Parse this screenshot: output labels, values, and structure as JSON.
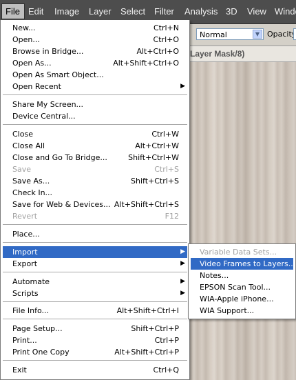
{
  "menubar": {
    "items": [
      "File",
      "Edit",
      "Image",
      "Layer",
      "Select",
      "Filter",
      "Analysis",
      "3D",
      "View",
      "Windo"
    ]
  },
  "options": {
    "blend_mode": "Normal",
    "opacity_label": "Opacity:"
  },
  "document_tab": "Layer Mask/8)",
  "file_menu": {
    "items": [
      {
        "label": "New...",
        "shortcut": "Ctrl+N"
      },
      {
        "label": "Open...",
        "shortcut": "Ctrl+O"
      },
      {
        "label": "Browse in Bridge...",
        "shortcut": "Alt+Ctrl+O"
      },
      {
        "label": "Open As...",
        "shortcut": "Alt+Shift+Ctrl+O"
      },
      {
        "label": "Open As Smart Object...",
        "shortcut": ""
      },
      {
        "label": "Open Recent",
        "shortcut": "",
        "submenu": true
      },
      {
        "label": "Share My Screen...",
        "shortcut": ""
      },
      {
        "label": "Device Central...",
        "shortcut": ""
      },
      {
        "label": "Close",
        "shortcut": "Ctrl+W"
      },
      {
        "label": "Close All",
        "shortcut": "Alt+Ctrl+W"
      },
      {
        "label": "Close and Go To Bridge...",
        "shortcut": "Shift+Ctrl+W"
      },
      {
        "label": "Save",
        "shortcut": "Ctrl+S",
        "disabled": true
      },
      {
        "label": "Save As...",
        "shortcut": "Shift+Ctrl+S"
      },
      {
        "label": "Check In...",
        "shortcut": ""
      },
      {
        "label": "Save for Web & Devices...",
        "shortcut": "Alt+Shift+Ctrl+S"
      },
      {
        "label": "Revert",
        "shortcut": "F12",
        "disabled": true
      },
      {
        "label": "Place...",
        "shortcut": ""
      },
      {
        "label": "Import",
        "shortcut": "",
        "submenu": true,
        "highlighted": true
      },
      {
        "label": "Export",
        "shortcut": "",
        "submenu": true
      },
      {
        "label": "Automate",
        "shortcut": "",
        "submenu": true
      },
      {
        "label": "Scripts",
        "shortcut": "",
        "submenu": true
      },
      {
        "label": "File Info...",
        "shortcut": "Alt+Shift+Ctrl+I"
      },
      {
        "label": "Page Setup...",
        "shortcut": "Shift+Ctrl+P"
      },
      {
        "label": "Print...",
        "shortcut": "Ctrl+P"
      },
      {
        "label": "Print One Copy",
        "shortcut": "Alt+Shift+Ctrl+P"
      },
      {
        "label": "Exit",
        "shortcut": "Ctrl+Q"
      }
    ]
  },
  "import_submenu": {
    "items": [
      {
        "label": "Variable Data Sets...",
        "disabled": true
      },
      {
        "label": "Video Frames to Layers...",
        "highlighted": true
      },
      {
        "label": "Notes..."
      },
      {
        "label": "EPSON Scan Tool..."
      },
      {
        "label": "WIA-Apple iPhone..."
      },
      {
        "label": "WIA Support..."
      }
    ]
  },
  "icons": {
    "submenu_arrow": "▶",
    "dropdown_arrow": "▼"
  },
  "colors": {
    "highlight": "#316ac5",
    "menubar": "#4d4d4d",
    "disabled_text": "#a0a0a0"
  }
}
